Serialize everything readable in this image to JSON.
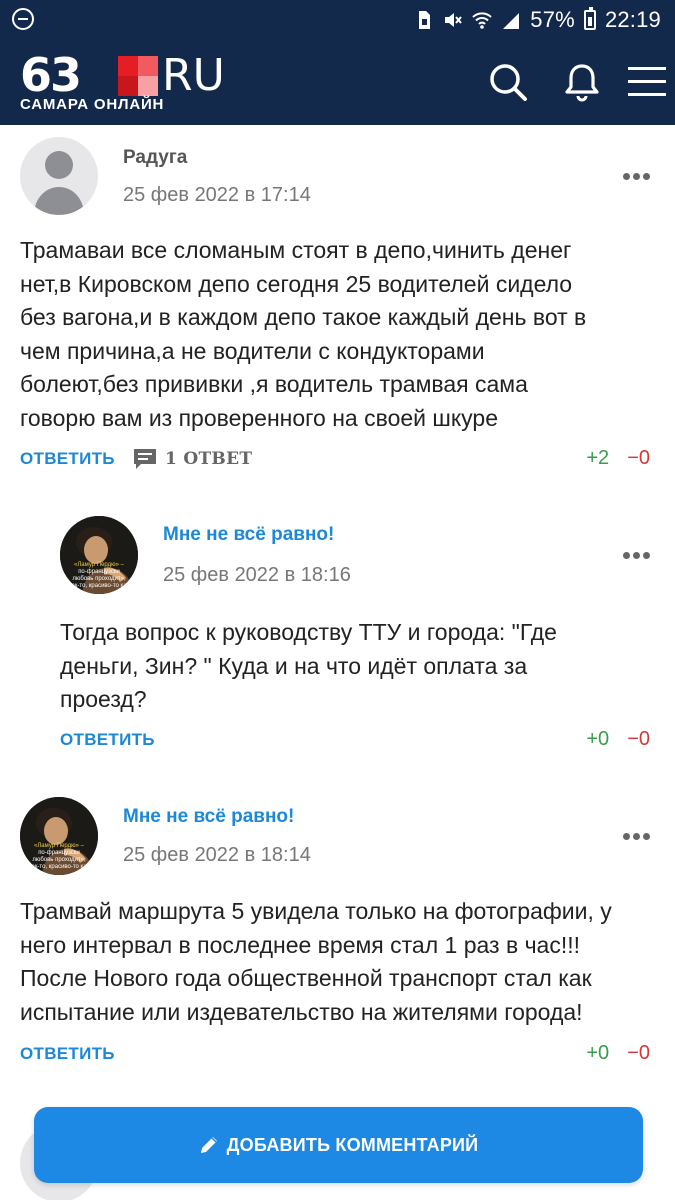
{
  "status_bar": {
    "battery": "57%",
    "time": "22:19"
  },
  "header": {
    "logo_number": "63",
    "logo_ru": "RU",
    "logo_subtitle": "САМАРА ОНЛАЙН",
    "logo_colors": [
      "#e31e24",
      "#f15a5f",
      "#f7a1a4",
      "#c8161c"
    ]
  },
  "comments": [
    {
      "author": "Радуга",
      "date": "25 фев 2022 в 17:14",
      "text_lines": [
        "Трамаваи все сломаным стоят в депо,чинить денег",
        "нет,в Кировском депо сегодня 25 водителей сидело",
        "без вагона,и в каждом депо такое каждый день вот в",
        "чем причина,а не водители с кондукторами",
        "болеют,без прививки ,я водитель трамвая сама",
        "говорю вам из проверенного на своей шкуре"
      ],
      "reply_label": "ОТВЕТИТЬ",
      "replies_label": "1 ОТВЕТ",
      "votes_up": "+2",
      "votes_down": "−0"
    },
    {
      "author": "Мне не всё равно!",
      "date": "25 фев 2022 в 18:16",
      "text_lines": [
        "Тогда вопрос к руководству ТТУ и города: \"Где",
        "деньги, Зин? \" Куда и на что идёт оплата за",
        "проезд?"
      ],
      "reply_label": "ОТВЕТИТЬ",
      "votes_up": "+0",
      "votes_down": "−0"
    },
    {
      "author": "Мне не всё равно!",
      "date": "25 фев 2022 в 18:14",
      "text_lines": [
        "Трамвай маршрута 5 увидела только на фотографии, у",
        "него интервал в последнее время стал 1 раз в час!!!",
        "После Нового года общественной транспорт стал как",
        "испытание или издевательство на жителями города!"
      ],
      "reply_label": "ОТВЕТИТЬ",
      "votes_up": "+0",
      "votes_down": "−0"
    }
  ],
  "avatar_caption_lines": [
    "«Ламур Пердю» –",
    "по-французски",
    "любовь проходит»,",
    "как-то, красиво-то как"
  ],
  "add_comment_label": "ДОБАВИТЬ КОММЕНТАРИЙ",
  "icons": [
    "status-circle-icon",
    "sim-icon",
    "mute-icon",
    "wifi-icon",
    "signal-icon",
    "battery-icon",
    "search-icon",
    "bell-icon",
    "menu-icon",
    "more-icon",
    "comment-bubble-icon",
    "pencil-icon"
  ],
  "colors": {
    "header_bg": "#13294b",
    "link_blue": "#1e88d8",
    "button_blue": "#1e88e5",
    "vote_up": "#3a9d4a",
    "vote_down": "#d43838"
  }
}
